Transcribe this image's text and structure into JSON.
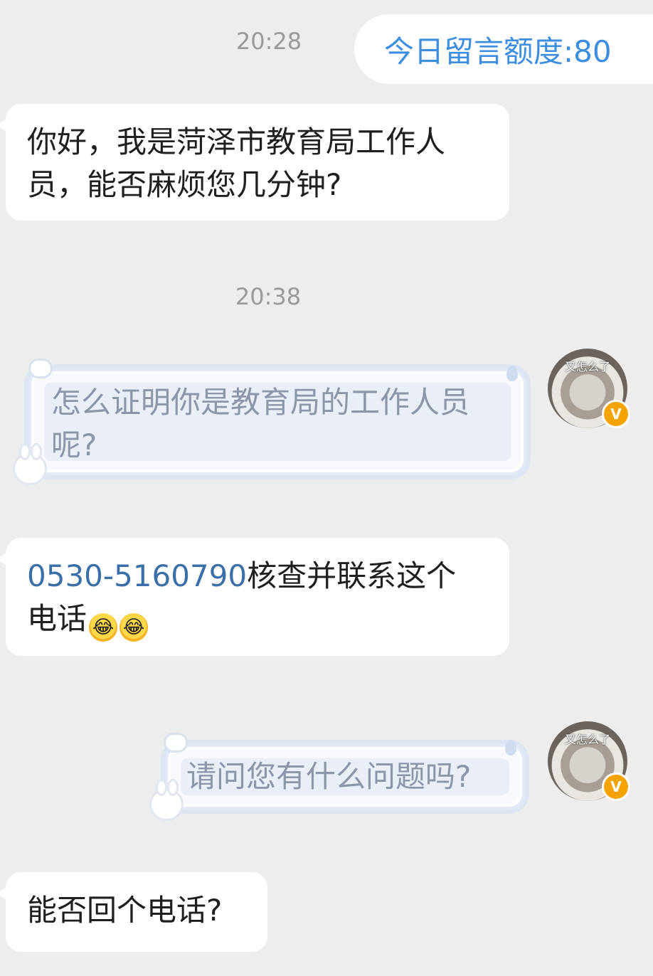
{
  "header": {
    "quota_label": "今日留言额度:80"
  },
  "timestamps": [
    "20:28",
    "20:38"
  ],
  "messages": [
    {
      "side": "in",
      "line1": "你好，我是菏泽市教育局工作人",
      "line2": "员，能否麻烦您几分钟?"
    },
    {
      "side": "out",
      "line1": "怎么证明你是教育局的工作人员",
      "line2": "呢?"
    },
    {
      "side": "in",
      "phone": "0530-5160790",
      "line1_rest": "核查并联系这个",
      "line2": "电话"
    },
    {
      "side": "out",
      "line1": "请问您有什么问题吗?"
    },
    {
      "side": "in",
      "line1": "能否回个电话?"
    }
  ],
  "avatar": {
    "caption": "又怎么了",
    "badge": "V"
  },
  "emoji": {
    "name": "rolling-on-the-floor-laughing",
    "glyph": "😂"
  },
  "colors": {
    "background": "#ededed",
    "bubble_in": "#ffffff",
    "quota_text": "#3d8ee0",
    "link": "#3b6fa8",
    "deco_text": "#8b96a8",
    "badge": "#f5a300"
  }
}
